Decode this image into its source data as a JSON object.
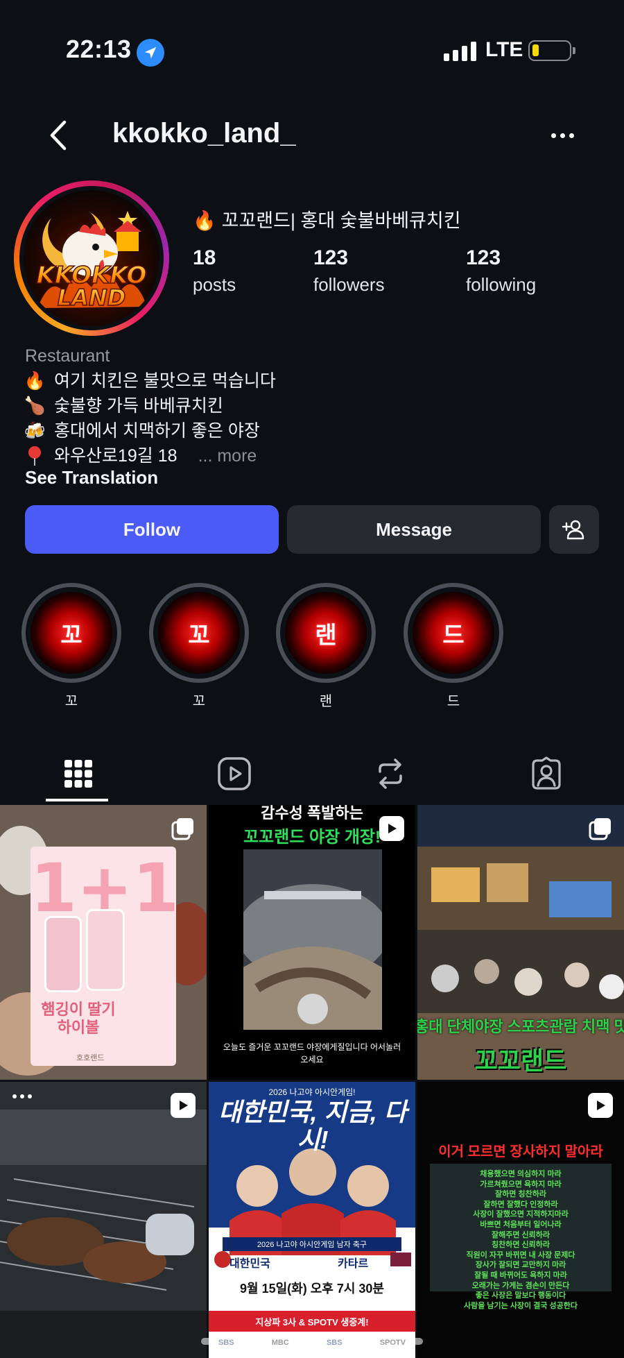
{
  "status_bar": {
    "time": "22:13",
    "network": "LTE"
  },
  "header": {
    "username": "kkokko_land_"
  },
  "profile": {
    "avatar_text": "KKOKKO LAND",
    "business_name": "꼬꼬랜드| 홍대 숯불바베큐치킨",
    "stats": [
      {
        "value": "18",
        "label": "posts"
      },
      {
        "value": "123",
        "label": "followers"
      },
      {
        "value": "123",
        "label": "following"
      }
    ],
    "category": "Restaurant",
    "bio_lines": [
      {
        "icon": "fire-icon",
        "text": "여기 치킨은 불맛으로 먹습니다"
      },
      {
        "icon": "drumstick-icon",
        "text": "숯불향 가득 바베큐치킨"
      },
      {
        "icon": "beer-mugs-icon",
        "text": "홍대에서 치맥하기 좋은 야장"
      },
      {
        "icon": "pin-icon",
        "text": "와우산로19길 18"
      }
    ],
    "more_label": "... more",
    "see_translation": "See Translation"
  },
  "actions": {
    "follow": "Follow",
    "message": "Message"
  },
  "highlights": [
    {
      "glyph": "꼬",
      "label": "꼬"
    },
    {
      "glyph": "꼬",
      "label": "꼬"
    },
    {
      "glyph": "랜",
      "label": "랜"
    },
    {
      "glyph": "드",
      "label": "드"
    }
  ],
  "tabs": [
    "grid-icon",
    "reels-icon",
    "reposts-icon",
    "tagged-icon"
  ],
  "posts": [
    {
      "type": "carousel",
      "caption_top": "1+1",
      "caption_bottom": "햄깅이 딸기 하이볼",
      "brand": "호호랜드"
    },
    {
      "type": "reel",
      "caption_top": "감수성 폭발하는",
      "caption_mid": "꼬꼬랜드 야장 개장!",
      "caption_bottom": "오늘도 즐거운 꼬꼬랜드 야장에게질입니다 어서놀러오세요"
    },
    {
      "type": "carousel",
      "caption_mid": "홍대 단체야장 스포츠관람 치맥 맛",
      "caption_bottom": "꼬꼬랜드"
    },
    {
      "type": "reel",
      "caption_top": ""
    },
    {
      "type": "image",
      "caption_top": "2026 나고야 아시안게임!",
      "headline": "대한민국, 지금, 다시!",
      "event": "2026 나고야 아시안게임 남자 축구",
      "team_a": "대한민국",
      "team_b": "카타르",
      "date": "9월 15일(화) 오후 7시 30분",
      "broadcast": "지상파 3사 & SPOTV 생중계!",
      "channels": [
        "SBS",
        "MBC",
        "SBS",
        "SPOTV"
      ]
    },
    {
      "type": "reel",
      "caption_top": "이거 모르면 장사하지 말아라",
      "lines": [
        "채용했으면 의심하지 마라",
        "가르쳐줬으면 욕하지 마라",
        "잘하면 칭찬하라",
        "잘하면 잘했다 인정하라",
        "사장이 잘했으면 지적하지마라",
        "바쁘면 처음부터 일어나라",
        "잘해주면 신뢰하라",
        "칭찬하면 신뢰하라",
        "직원이 자꾸 바뀌면 내 사장 문제다",
        "장사가 잘되면 교만하지 마라",
        "잘될 때 바뀌어도 욕하지 마라",
        "오래가는 가게는 겸손이 만든다",
        "좋은 사장은 말보다 행동이다",
        "사람을 남기는 사장이 결국 성공한다"
      ]
    }
  ],
  "colors": {
    "background": "#0c0f14",
    "follow_button": "#4a5cf5",
    "secondary_button": "#262a31",
    "highlight_glow": "#ff2a2a"
  }
}
